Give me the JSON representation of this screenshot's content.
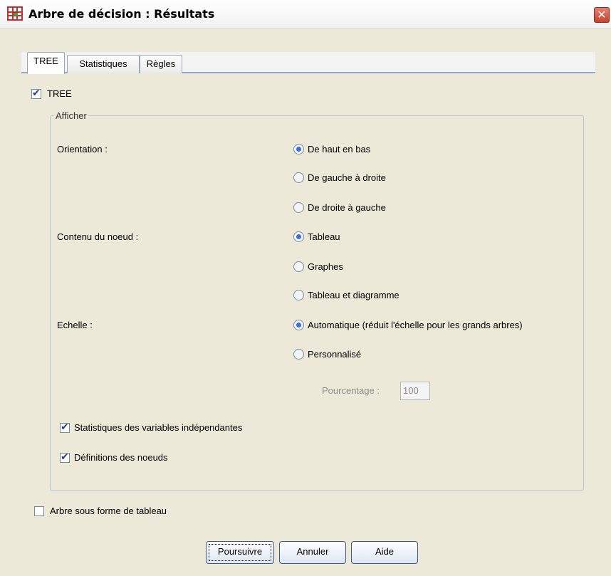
{
  "window": {
    "title": "Arbre de décision : Résultats",
    "close_glyph": "✕"
  },
  "tabs": [
    {
      "label": "TREE",
      "active": true
    },
    {
      "label": "Statistiques",
      "active": false
    },
    {
      "label": "Règles",
      "active": false
    }
  ],
  "tree_checkbox": {
    "label": "TREE",
    "checked": true
  },
  "display_group": {
    "legend": "Afficher",
    "orientation": {
      "label": "Orientation :",
      "options": [
        {
          "label": "De haut en bas",
          "selected": true
        },
        {
          "label": "De gauche à droite",
          "selected": false
        },
        {
          "label": "De droite à gauche",
          "selected": false
        }
      ]
    },
    "node_content": {
      "label": "Contenu du noeud :",
      "options": [
        {
          "label": "Tableau",
          "selected": true
        },
        {
          "label": "Graphes",
          "selected": false
        },
        {
          "label": "Tableau et diagramme",
          "selected": false
        }
      ]
    },
    "scale": {
      "label": "Echelle :",
      "options": [
        {
          "label": "Automatique (réduit l'échelle pour les grands arbres)",
          "selected": true
        },
        {
          "label": "Personnalisé",
          "selected": false
        }
      ],
      "percentage_label": "Pourcentage :",
      "percentage_value": "100"
    },
    "independent_stats": {
      "label": "Statistiques des variables indépendantes",
      "checked": true
    },
    "node_definitions": {
      "label": "Définitions des noeuds",
      "checked": true
    }
  },
  "tree_as_table": {
    "label": "Arbre sous forme de tableau",
    "checked": false
  },
  "buttons": {
    "continue": "Poursuivre",
    "cancel": "Annuler",
    "help": "Aide"
  }
}
